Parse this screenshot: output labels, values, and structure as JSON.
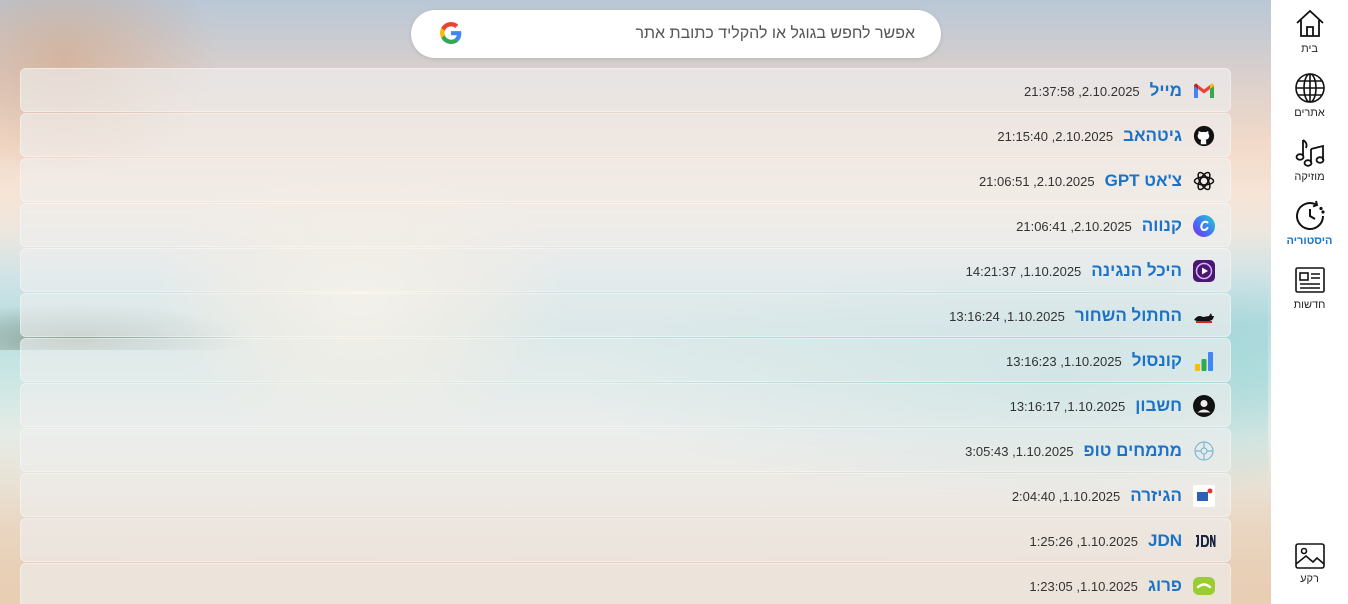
{
  "search": {
    "placeholder": "אפשר לחפש בגוגל או להקליד כתובת אתר"
  },
  "sidebar": {
    "items": [
      {
        "label": "בית",
        "icon": "home-icon",
        "active": false
      },
      {
        "label": "אתרים",
        "icon": "globe-icon",
        "active": false
      },
      {
        "label": "מוזיקה",
        "icon": "music-icon",
        "active": false
      },
      {
        "label": "היסטוריה",
        "icon": "history-icon",
        "active": true
      },
      {
        "label": "חדשות",
        "icon": "news-icon",
        "active": false
      }
    ],
    "bottom_item": {
      "label": "רקע",
      "icon": "image-icon"
    }
  },
  "history": [
    {
      "name": "מייל",
      "time": "21:37:58 ,2.10.2025",
      "icon": "gmail-icon"
    },
    {
      "name": "גיטהאב",
      "time": "21:15:40 ,2.10.2025",
      "icon": "github-icon"
    },
    {
      "name": "צ'אט GPT",
      "time": "21:06:51 ,2.10.2025",
      "icon": "chatgpt-icon"
    },
    {
      "name": "קנווה",
      "time": "21:06:41 ,2.10.2025",
      "icon": "canva-icon"
    },
    {
      "name": "היכל הנגינה",
      "time": "14:21:37 ,1.10.2025",
      "icon": "music-hall-icon"
    },
    {
      "name": "החתול השחור",
      "time": "13:16:24 ,1.10.2025",
      "icon": "black-cat-icon"
    },
    {
      "name": "קונסול",
      "time": "13:16:23 ,1.10.2025",
      "icon": "console-icon"
    },
    {
      "name": "חשבון",
      "time": "13:16:17 ,1.10.2025",
      "icon": "account-icon"
    },
    {
      "name": "מתמחים טופ",
      "time": "3:05:43 ,1.10.2025",
      "icon": "mitmachim-icon"
    },
    {
      "name": "הגיזרה",
      "time": "2:04:40 ,1.10.2025",
      "icon": "hagizra-icon"
    },
    {
      "name": "JDN",
      "time": "1:25:26 ,1.10.2025",
      "icon": "jdn-icon"
    },
    {
      "name": "פרוג",
      "time": "1:23:05 ,1.10.2025",
      "icon": "prog-icon"
    }
  ]
}
